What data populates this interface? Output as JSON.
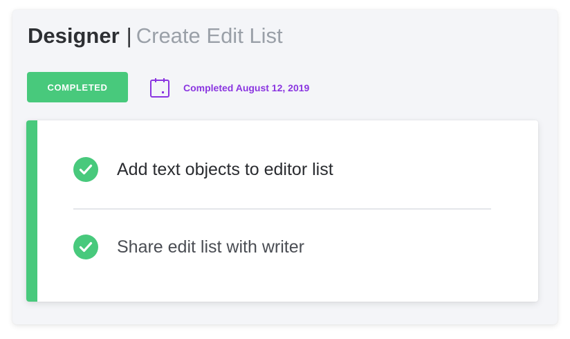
{
  "header": {
    "role": "Designer",
    "separator": "|",
    "task_title": "Create Edit List"
  },
  "status": {
    "badge_label": "COMPLETED",
    "date_text": "Completed August 12, 2019",
    "icon": "calendar-icon"
  },
  "tasks": [
    {
      "label": "Add text objects to editor list",
      "done": true,
      "icon": "check-circle-icon"
    },
    {
      "label": "Share edit list with writer",
      "done": true,
      "icon": "check-circle-icon"
    }
  ],
  "colors": {
    "success": "#48c97c",
    "date_accent": "#8a35e0",
    "title": "#2d2f33",
    "subtitle": "#9aa0a8"
  }
}
